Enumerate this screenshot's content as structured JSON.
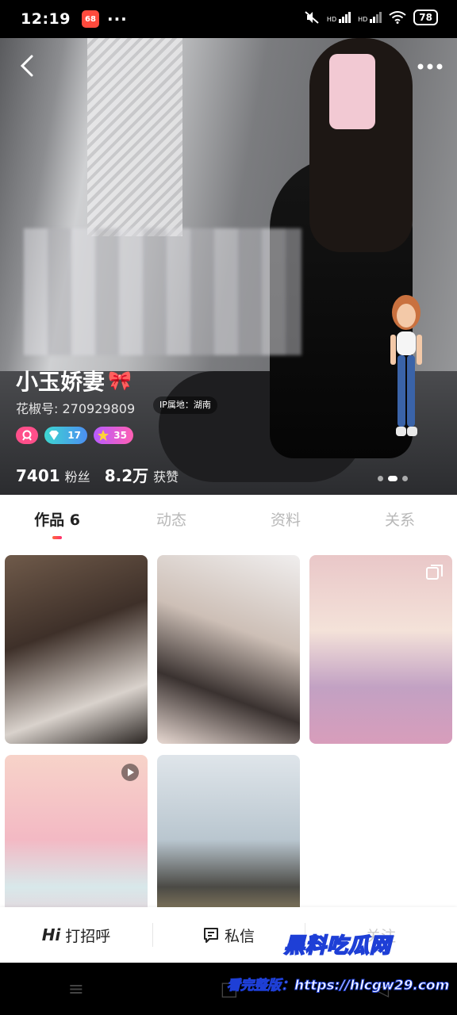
{
  "status_bar": {
    "time": "12:19",
    "app_badge": "68",
    "more": "···",
    "network_1": "HD",
    "network_2": "HD",
    "battery": "78"
  },
  "header": {
    "back_icon": "chevron-left-icon",
    "more_icon": "more-horizontal-icon"
  },
  "profile": {
    "name": "小玉娇妻",
    "name_emoji": "🎀",
    "id_label": "花椒号:",
    "id_value": "270929809",
    "ip_location": "IP属地：湖南",
    "badges": [
      {
        "icon": "level-icon",
        "value": ""
      },
      {
        "icon": "diamond-icon",
        "value": "17"
      },
      {
        "icon": "star-icon",
        "value": "35"
      }
    ],
    "fans_count": "7401",
    "fans_label": "粉丝",
    "likes_count": "8.2万",
    "likes_label": "获赞",
    "photo_pager": {
      "count": 3,
      "active": 2
    }
  },
  "tabs": [
    {
      "label": "作品 6",
      "active": true
    },
    {
      "label": "动态",
      "active": false
    },
    {
      "label": "资料",
      "active": false
    },
    {
      "label": "关系",
      "active": false
    }
  ],
  "works": [
    {
      "type": "photo"
    },
    {
      "type": "photo"
    },
    {
      "type": "multi-photo",
      "icon": "multi-image-icon"
    },
    {
      "type": "video",
      "icon": "play-icon"
    },
    {
      "type": "photo"
    }
  ],
  "action_bar": {
    "greet_prefix": "Hi",
    "greet_label": "打招呼",
    "message_label": "私信",
    "follow_label": "关注"
  },
  "watermark": {
    "line1": "黑料吃瓜网",
    "line2": "看完整版：https://hlcgw29.com"
  },
  "colors": {
    "accent": "#ff2d6f",
    "tab_indicator_start": "#ff6a3d",
    "watermark_blue": "#1e3fd6"
  }
}
